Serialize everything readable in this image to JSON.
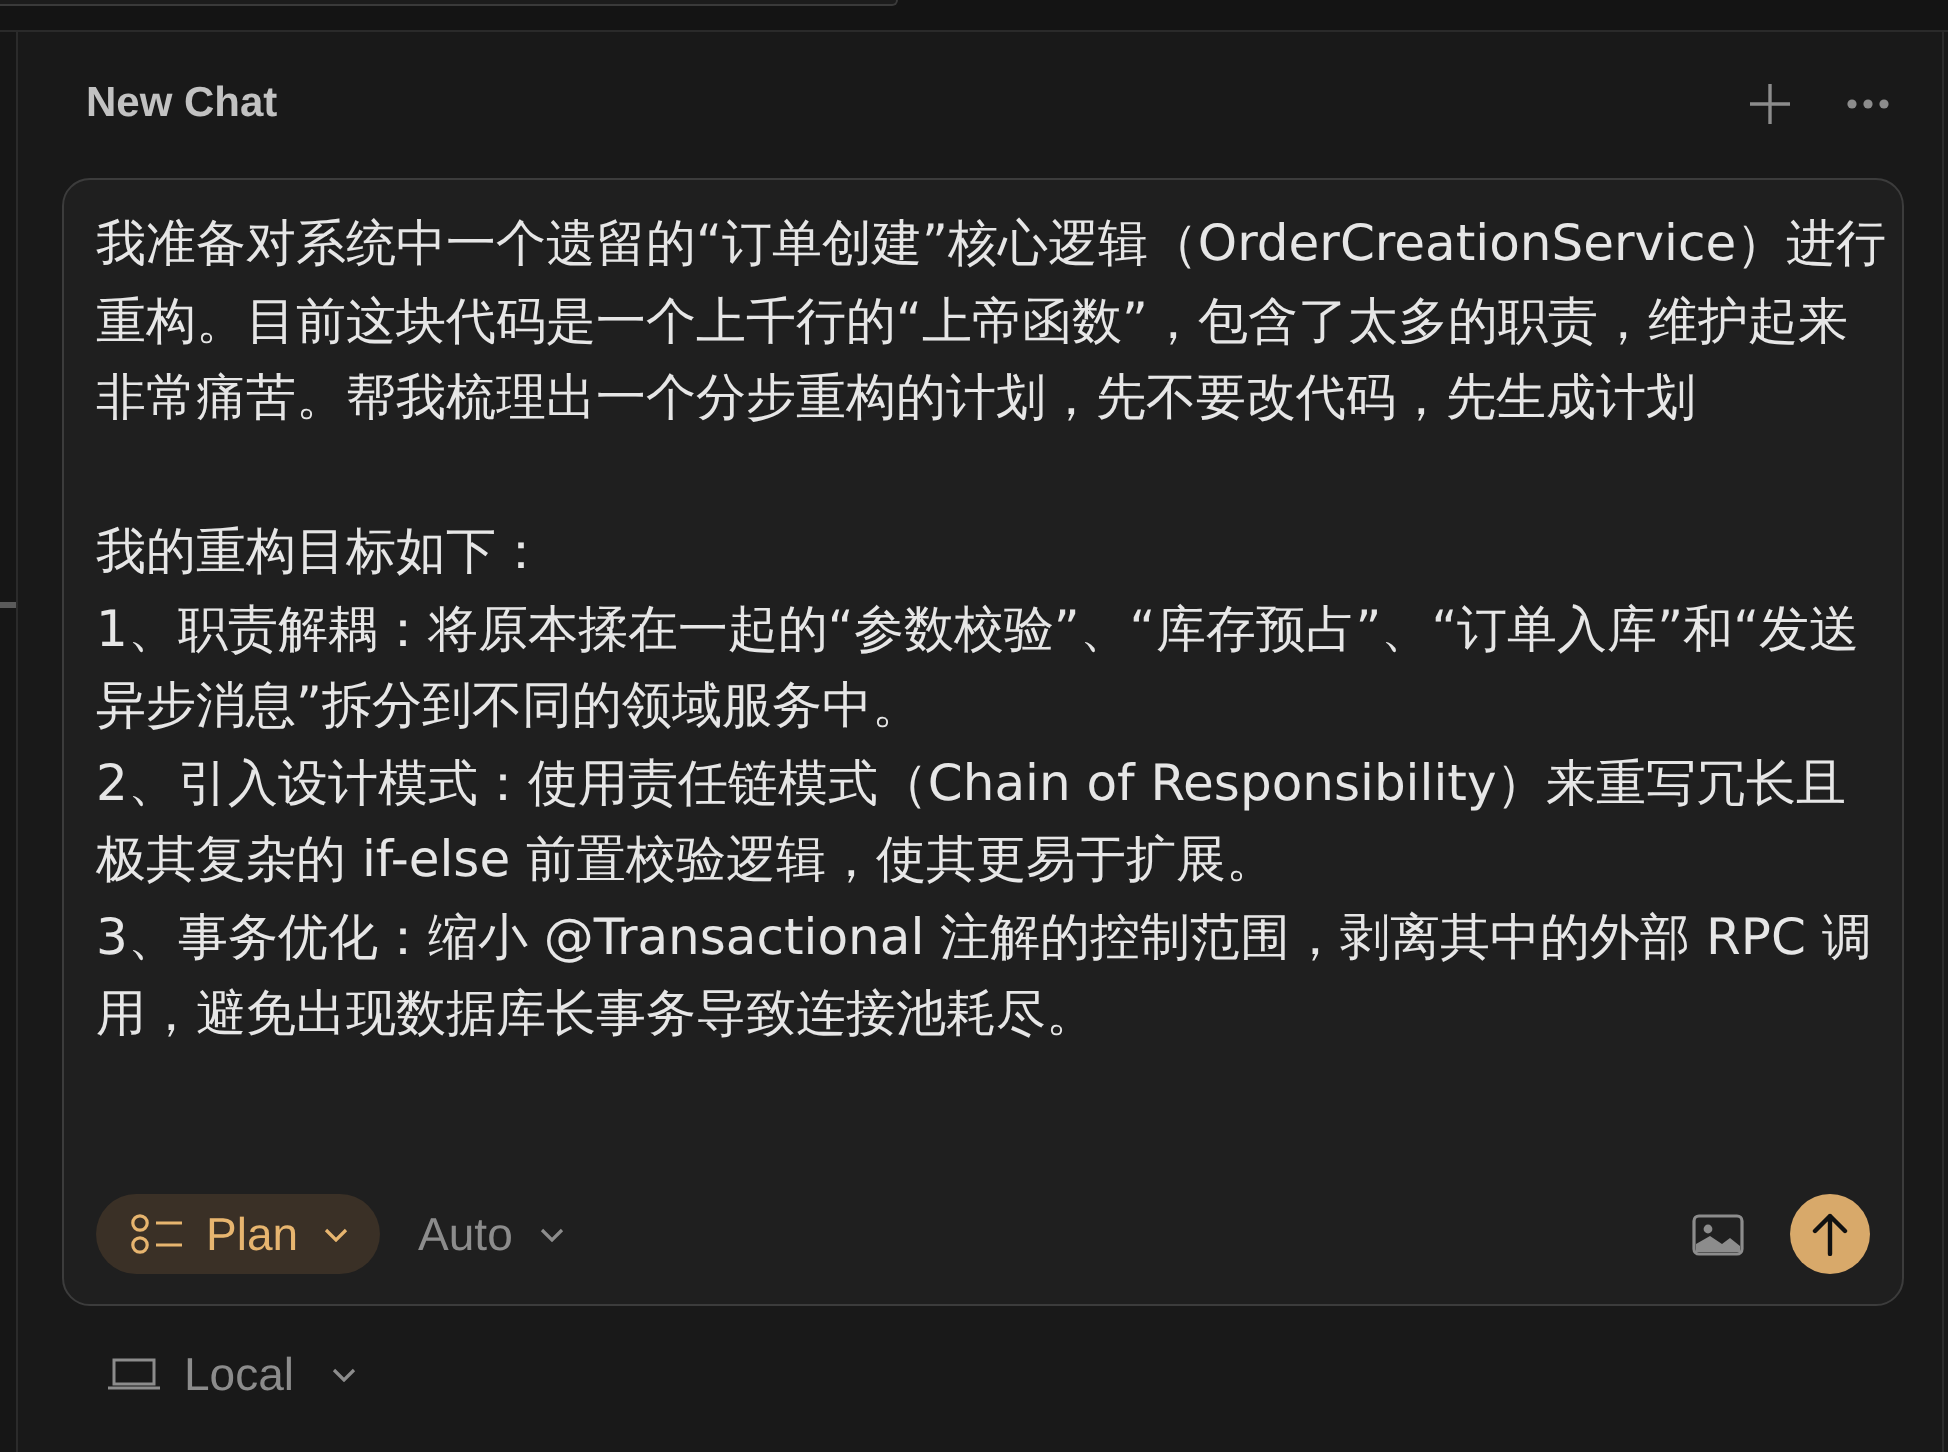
{
  "header": {
    "title": "New Chat"
  },
  "composer": {
    "message": {
      "intro": "我准备对系统中一个遗留的“订单创建”核心逻辑（OrderCreationService）进行重构。目前这块代码是一个上千行的“上帝函数”，包含了太多的职责，维护起来非常痛苦。帮我梳理出一个分步重构的计划，先不要改代码，先生成计划",
      "goals_heading": "我的重构目标如下：",
      "goals": [
        "1、职责解耦：将原本揉在一起的“参数校验”、“库存预占”、“订单入库”和“发送异步消息”拆分到不同的领域服务中。",
        "2、引入设计模式：使用责任链模式（Chain of Responsibility）来重写冗长且极其复杂的 if-else 前置校验逻辑，使其更易于扩展。",
        "3、事务优化：缩小 @Transactional 注解的控制范围，剥离其中的外部 RPC 调用，避免出现数据库长事务导致连接池耗尽。"
      ]
    },
    "mode_picker": {
      "label": "Plan",
      "active": true
    },
    "model_picker": {
      "label": "Auto"
    }
  },
  "environment_picker": {
    "label": "Local"
  }
}
